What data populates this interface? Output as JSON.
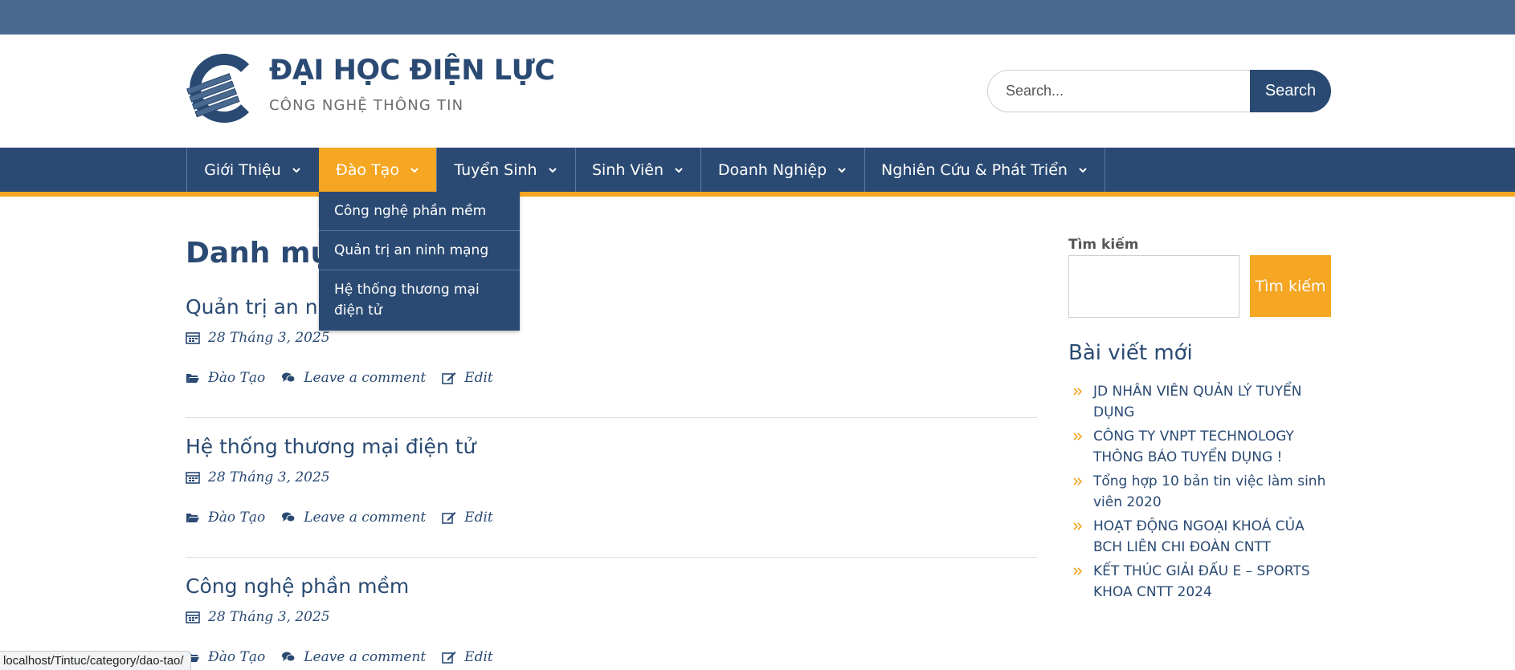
{
  "header": {
    "title": "ĐẠI HỌC ĐIỆN LỰC",
    "tagline": "CÔNG NGHỆ THÔNG TIN",
    "search_placeholder": "Search...",
    "search_button": "Search"
  },
  "nav": {
    "items": [
      {
        "label": "Giới Thiệu"
      },
      {
        "label": "Đào Tạo"
      },
      {
        "label": "Tuyển Sinh"
      },
      {
        "label": "Sinh Viên"
      },
      {
        "label": "Doanh Nghiệp"
      },
      {
        "label": "Nghiên Cứu & Phát Triển"
      }
    ],
    "active_index": 1,
    "dropdown": [
      "Công nghệ phần mềm",
      "Quản trị an ninh mạng",
      "Hệ thống thương mại điện tử"
    ]
  },
  "main": {
    "page_title": "Danh mục: Đào Tạo",
    "posts": [
      {
        "title": "Quản trị an ninh mạng",
        "date": "28 Tháng 3, 2025",
        "category": "Đào Tạo",
        "comment": "Leave a comment",
        "edit": "Edit"
      },
      {
        "title": "Hệ thống thương mại điện tử",
        "date": "28 Tháng 3, 2025",
        "category": "Đào Tạo",
        "comment": "Leave a comment",
        "edit": "Edit"
      },
      {
        "title": "Công nghệ phần mềm",
        "date": "28 Tháng 3, 2025",
        "category": "Đào Tạo",
        "comment": "Leave a comment",
        "edit": "Edit"
      }
    ]
  },
  "sidebar": {
    "search_label": "Tìm kiếm",
    "search_button": "Tìm kiếm",
    "recent_heading": "Bài viết mới",
    "recent_posts": [
      "JD NHÂN VIÊN QUẢN LÝ TUYỂN DỤNG",
      "CÔNG TY VNPT TECHNOLOGY THÔNG BÁO TUYỂN DỤNG !",
      "Tổng hợp 10 bản tin việc làm sinh viên 2020",
      "HOẠT ĐỘNG NGOẠI KHOÁ CỦA BCH LIÊN CHI ĐOÀN CNTT",
      "KẾT THÚC GIẢI ĐẤU E – SPORTS KHOA CNTT 2024"
    ]
  },
  "statusbar": {
    "url": "localhost/Tintuc/category/dao-tao/"
  },
  "colors": {
    "primary": "#2a4a73",
    "accent": "#f5a623",
    "topbar": "#49698f"
  },
  "icons": {
    "logo": "electric-c-logo",
    "date": "calendar-icon",
    "category": "folder-open-icon",
    "comment": "comments-icon",
    "edit": "edit-icon",
    "nav_dropdown": "chevron-down-icon",
    "list_bullet": "double-chevron-right-icon"
  }
}
